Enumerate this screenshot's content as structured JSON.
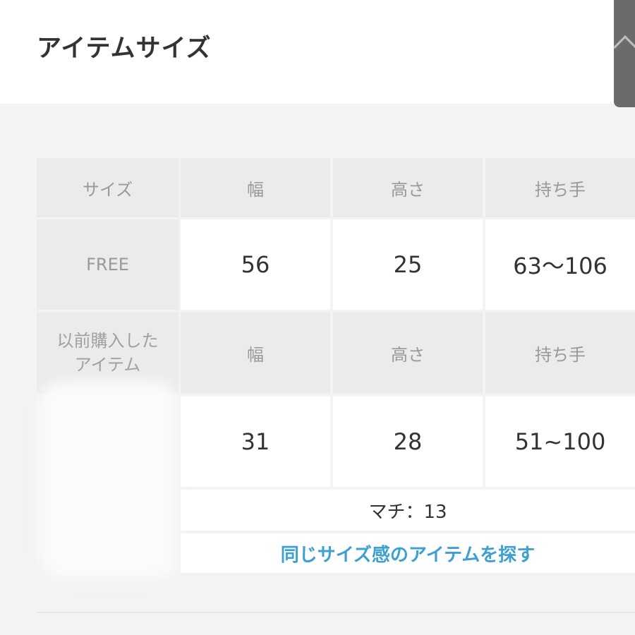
{
  "header": {
    "title": "アイテムサイズ"
  },
  "size_table": {
    "columns": [
      "サイズ",
      "幅",
      "高さ",
      "持ち手"
    ],
    "rows": [
      {
        "size": "FREE",
        "width": "56",
        "height": "25",
        "handle": "63〜106"
      }
    ]
  },
  "purchased_table": {
    "label": "以前購入したアイテム",
    "columns": [
      "幅",
      "高さ",
      "持ち手"
    ],
    "values": {
      "width": "31",
      "height": "28",
      "handle": "51~100"
    },
    "note": "マチ：13"
  },
  "actions": {
    "similar_link": "同じサイズ感のアイテムを探す"
  },
  "colors": {
    "link": "#3ca0d0",
    "header_bg": "#ebebeb",
    "text": "#333333",
    "muted": "#999999"
  },
  "icons": {
    "collapse": "chevron-up-icon"
  }
}
